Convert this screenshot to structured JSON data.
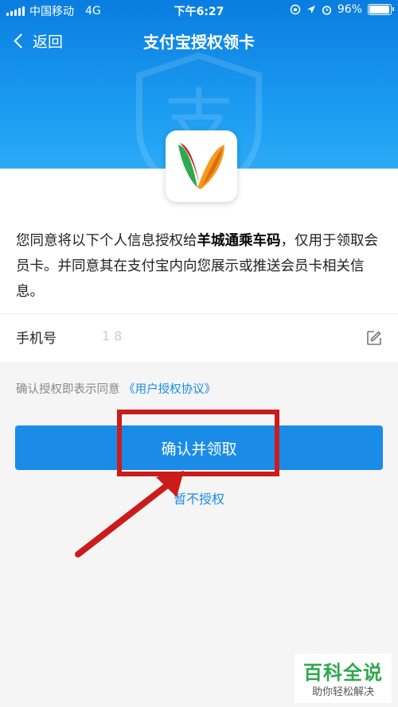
{
  "status_bar": {
    "carrier": "中国移动",
    "network": "4G",
    "time": "下午6:27",
    "battery": "96%",
    "battery_level": 0.96
  },
  "nav": {
    "back_label": "返回",
    "title": "支付宝授权领卡"
  },
  "consent": {
    "text_before": "您同意将以下个人信息授权给",
    "merchant": "羊城通乘车码",
    "text_after": "，仅用于领取会员卡。并同意其在支付宝内向您展示或推送会员卡相关信息。"
  },
  "phone": {
    "label": "手机号",
    "value": "1        8"
  },
  "agreement": {
    "prefix": "确认授权即表示同意",
    "link": "《用户授权协议》"
  },
  "buttons": {
    "confirm": "确认并领取",
    "deny": "暂不授权"
  },
  "watermark_brand": {
    "title": "百科全说",
    "subtitle": "助你轻松解决"
  },
  "colors": {
    "header_blue": "#1a8ce8",
    "highlight_red": "#cc1b1b",
    "brand_green": "#2fa84f"
  }
}
